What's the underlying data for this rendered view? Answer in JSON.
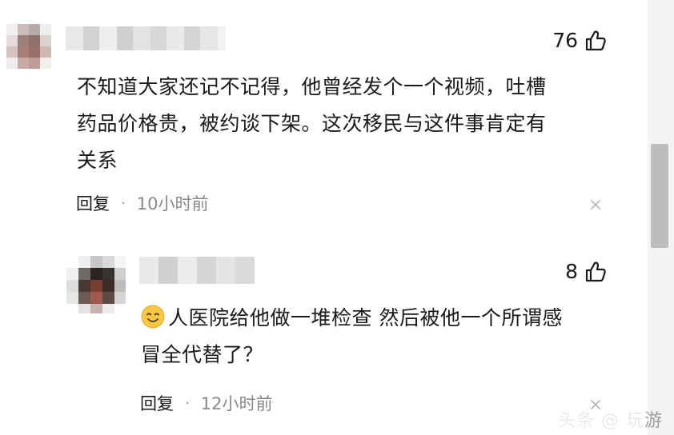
{
  "comments": [
    {
      "likes": "76",
      "text_lines": [
        "不知道大家还记不记得，他曾经发个一个视频，吐槽",
        "药品价格贵，被约谈下架。这次移民与这件事肯定有",
        "关系"
      ],
      "reply_label": "回复",
      "separator": "·",
      "time": "10小时前"
    },
    {
      "likes": "8",
      "emoji": "smile-emoji",
      "text_lines": [
        "人医院给他做一堆检查 然后被他一个所谓感",
        "冒全代替了？"
      ],
      "reply_label": "回复",
      "separator": "·",
      "time": "12小时前"
    }
  ],
  "watermark": {
    "faint": "头条 @ 玩",
    "visible": "游"
  },
  "colors": {
    "text": "#1a1a1a",
    "meta_time": "#8a8a8a",
    "scroll_thumb": "#bdbdbd"
  },
  "icons": [
    "thumb-up-icon",
    "close-icon",
    "smile-emoji"
  ]
}
